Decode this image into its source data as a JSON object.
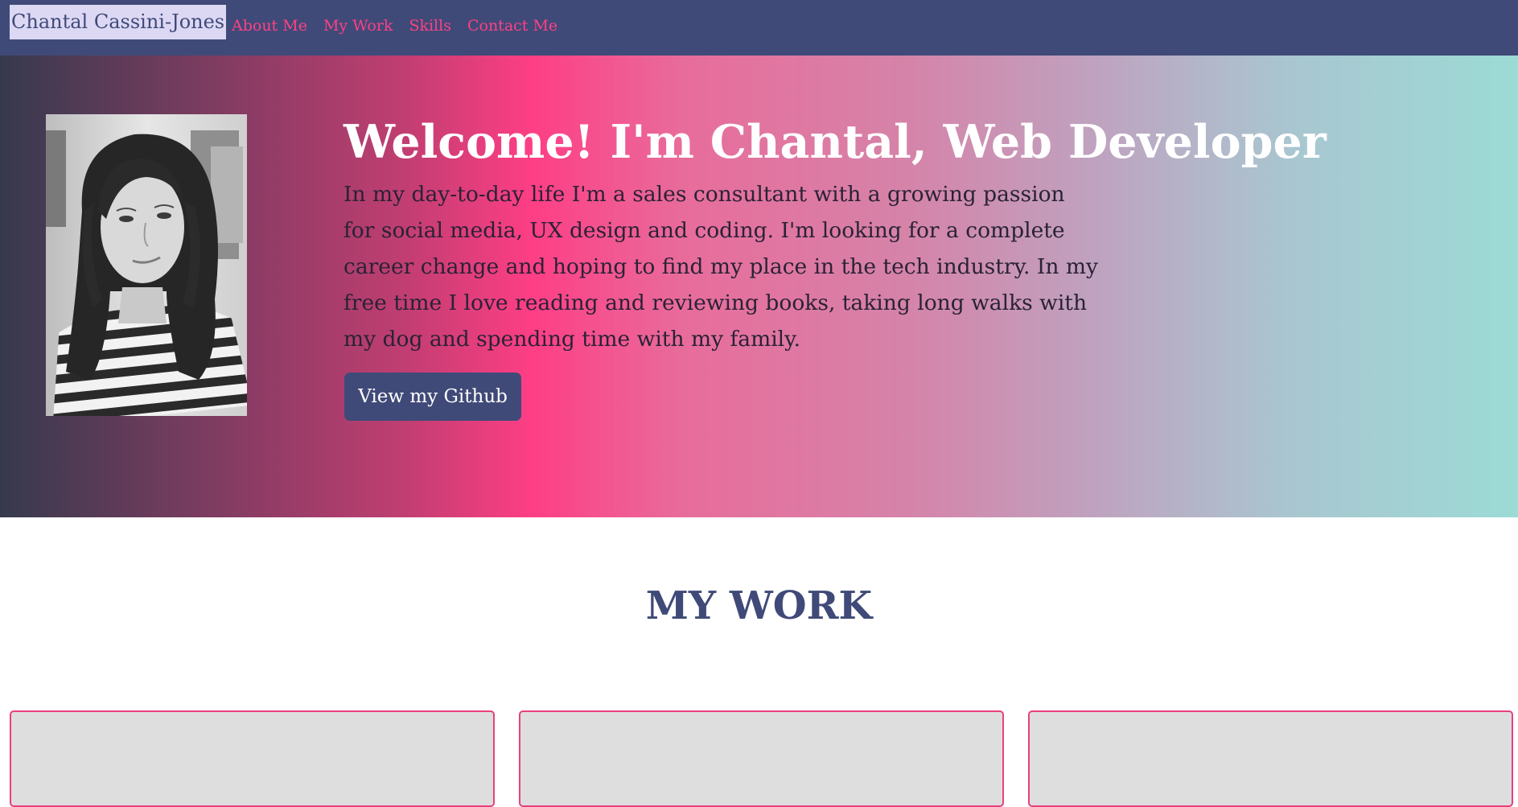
{
  "navbar": {
    "brand": "Chantal Cassini-Jones",
    "links": [
      "About Me",
      "My Work",
      "Skills",
      "Contact Me"
    ]
  },
  "hero": {
    "title": "Welcome! I'm Chantal, Web Developer",
    "text": "In my day-to-day life I'm a sales consultant with a growing passion for social media, UX design and coding. I'm looking for a complete career change and hoping to find my place in the tech industry. In my free time I love reading and reviewing books, taking long walks with my dog and spending time with my family.",
    "button_label": "View my Github"
  },
  "work": {
    "title": "MY WORK",
    "cards": [
      "",
      "",
      ""
    ]
  },
  "colors": {
    "navbar_bg": "#404a78",
    "nav_link": "#ff4084",
    "brand_bg": "#dcd8f4",
    "hero_pink": "#fe3e85",
    "hero_teal": "#9cdbd6",
    "card_border": "#e8407e",
    "card_bg": "#dedede"
  }
}
